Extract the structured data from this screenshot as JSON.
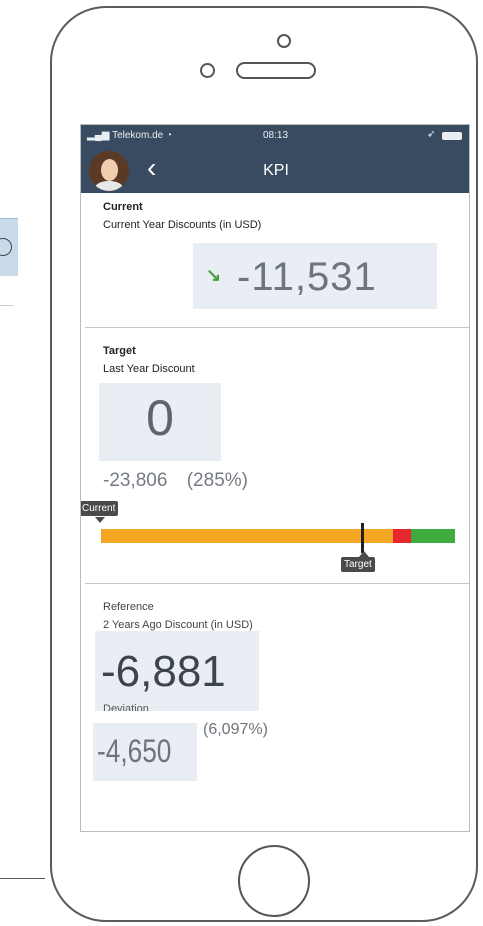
{
  "status_bar": {
    "carrier": "Telekom.de",
    "time": "08:13"
  },
  "nav": {
    "title": "KPI",
    "back_glyph": "‹"
  },
  "current": {
    "heading": "Current",
    "subtitle": "Current Year Discounts (in USD)",
    "trend_icon": "trend-down-arrow",
    "trend_glyph": "↘",
    "value": "-11,531"
  },
  "target": {
    "heading": "Target",
    "subtitle": "Last Year Discount",
    "value": "0",
    "deviation_value": "-23,806",
    "deviation_percent": "(285%)"
  },
  "bullet_chart": {
    "current_label": "Current",
    "target_label": "Target",
    "colors": {
      "below": "#f5a623",
      "critical": "#e8262b",
      "good": "#3eac3e"
    }
  },
  "reference": {
    "heading": "Reference",
    "subtitle": "2 Years Ago Discount (in USD)",
    "value": "-6,881",
    "deviation_label": "Deviation",
    "deviation_value": "-4,650",
    "deviation_percent": "(6,097%)"
  },
  "colors": {
    "header_bg": "#394b61",
    "kpi_box_bg": "#e9eef5",
    "trend_green": "#4aa03d"
  }
}
